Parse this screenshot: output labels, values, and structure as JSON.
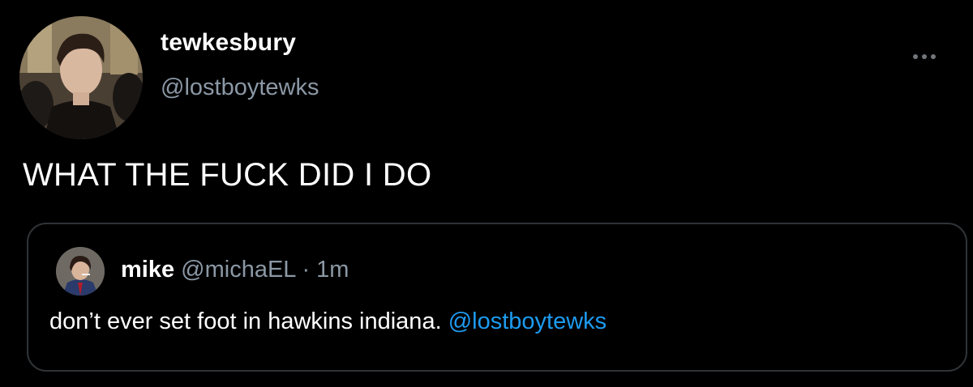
{
  "tweet": {
    "author": {
      "display_name": "tewkesbury",
      "handle": "@lostboytewks"
    },
    "text": "WHAT THE FUCK DID I DO",
    "more_icon": "more-horizontal-icon"
  },
  "quoted_tweet": {
    "author": {
      "display_name": "mike",
      "handle": "@michaEL"
    },
    "separator": "·",
    "time": "1m",
    "text": "don’t ever set foot in hawkins indiana.",
    "mention": "@lostboytewks"
  },
  "colors": {
    "background": "#000000",
    "text_primary": "#ffffff",
    "text_secondary": "#8b98a5",
    "link": "#1d9bf0",
    "border": "#2f3336"
  }
}
